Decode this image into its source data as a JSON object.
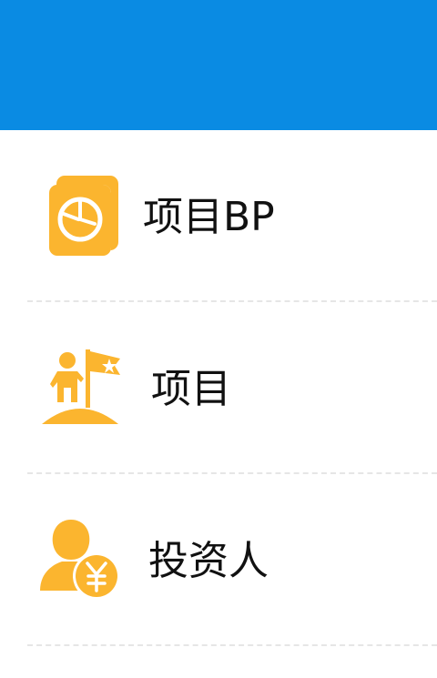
{
  "theme": {
    "header_color": "#0a8be3",
    "icon_color": "#fbb52f"
  },
  "menu": {
    "items": [
      {
        "label": "项目BP",
        "icon": "bp-document-chart-icon"
      },
      {
        "label": "项目",
        "icon": "flag-person-icon"
      },
      {
        "label": "投资人",
        "icon": "investor-yen-icon"
      }
    ]
  }
}
